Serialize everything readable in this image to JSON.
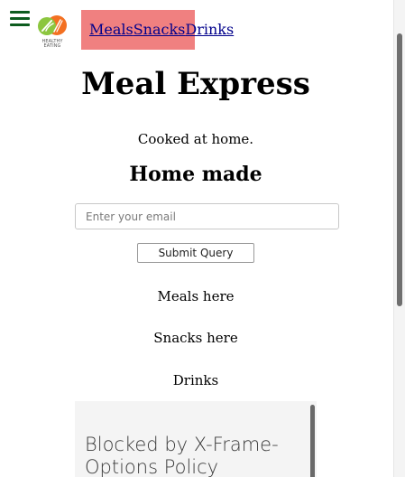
{
  "header": {
    "menu_icon": "hamburger-icon",
    "logo": {
      "icon": "healthy-eating-logo",
      "text": "HEALTHY EATING"
    },
    "nav": {
      "items": [
        {
          "label": "Meals"
        },
        {
          "label": "Snacks"
        },
        {
          "label": "Drinks"
        }
      ],
      "background_color": "#f08080",
      "link_color": "#00008b"
    }
  },
  "main": {
    "title": "Meal Express",
    "tagline": "Cooked at home.",
    "subtitle": "Home made",
    "email_form": {
      "placeholder": "Enter your email",
      "value": "",
      "submit_label": "Submit Query"
    },
    "sections": [
      {
        "text": "Meals here"
      },
      {
        "text": "Snacks here"
      },
      {
        "text": "Drinks"
      }
    ],
    "embedded_frame": {
      "message": "Blocked by X-Frame-Options Policy"
    }
  },
  "colors": {
    "menu_icon": "#0d5c1f",
    "logo_orange": "#f37021",
    "logo_green": "#8cc63f"
  }
}
